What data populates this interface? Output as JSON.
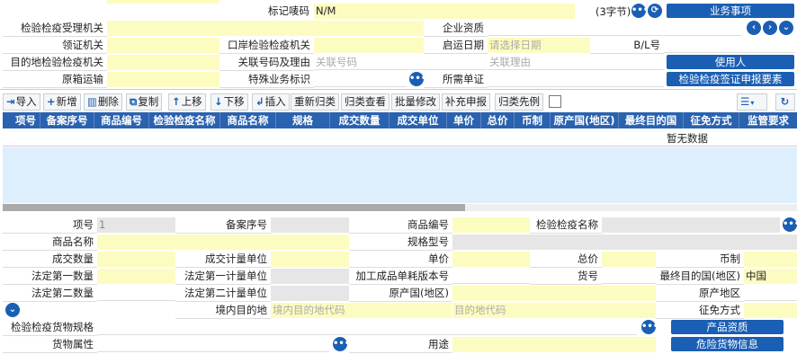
{
  "top": {
    "mark_code_label": "标记唛码",
    "mark_code_value": "N/M",
    "mark_code_hint": "(3字节)",
    "business_button": "业务事项",
    "cert_office_label": "检验检疫受理机关",
    "enterprise_qual_label": "企业资质",
    "receipt_office_label": "领证机关",
    "port_inspection_label": "口岸检验检疫机关",
    "departure_date_label": "启运日期",
    "departure_date_placeholder": "请选择日期",
    "bl_label": "B/L号",
    "dest_inspection_label": "目的地检验检疫机关",
    "related_no_label": "关联号码及理由",
    "related_no_placeholder": "关联号码",
    "related_reason_placeholder": "关联理由",
    "user_button": "使用人",
    "orig_box_label": "原箱运输",
    "special_label": "特殊业务标识",
    "required_docs_label": "所需单证",
    "cert_elements_button": "检验检疫签证申报要素"
  },
  "toolbar": {
    "import": "导入",
    "add": "新增",
    "delete": "删除",
    "copy": "复制",
    "move_up": "上移",
    "move_down": "下移",
    "insert": "插入",
    "reclassify": "重新归类",
    "classify_view": "归类查看",
    "batch_edit": "批量修改",
    "supplement": "补充申报",
    "classify_example": "归类先例"
  },
  "table": {
    "headers": [
      "项号",
      "备案序号",
      "商品编号",
      "检验检疫名称",
      "商品名称",
      "规格",
      "成交数量",
      "成交单位",
      "单价",
      "总价",
      "币制",
      "原产国(地区)",
      "最终目的国",
      "征免方式",
      "监管要求"
    ],
    "empty_text": "暂无数据"
  },
  "detail": {
    "item_no_label": "项号",
    "item_no_value": "1",
    "record_no_label": "备案序号",
    "goods_code_label": "商品编号",
    "ciq_name_label": "检验检疫名称",
    "goods_name_label": "商品名称",
    "spec_label": "规格型号",
    "qty_label": "成交数量",
    "qty_unit_label": "成交计量单位",
    "unit_price_label": "单价",
    "total_price_label": "总价",
    "currency_label": "币制",
    "legal_qty1_label": "法定第一数量",
    "legal_unit1_label": "法定第一计量单位",
    "version_label": "加工成品单耗版本号",
    "goods_no_label": "货号",
    "final_dest_label": "最终目的国(地区)",
    "final_dest_value": "中国",
    "legal_qty2_label": "法定第二数量",
    "legal_unit2_label": "法定第二计量单位",
    "origin_country_label": "原产国(地区)",
    "origin_region_label": "原产地区",
    "domestic_dest_label": "境内目的地",
    "domestic_dest_placeholder": "境内目的地代码",
    "dest_code_placeholder": "目的地代码",
    "exemption_label": "征免方式",
    "ciq_spec_label": "检验检疫货物规格",
    "product_qual_button": "产品资质",
    "goods_attr_label": "货物属性",
    "usage_label": "用途",
    "dangerous_button": "危险货物信息"
  },
  "colors": {
    "accent": "#1a5fb4",
    "header_bg": "#2a62b0",
    "required_field": "#fdfcc0",
    "readonly_field": "#e6e6e6",
    "grid_body": "#ddeefc"
  }
}
